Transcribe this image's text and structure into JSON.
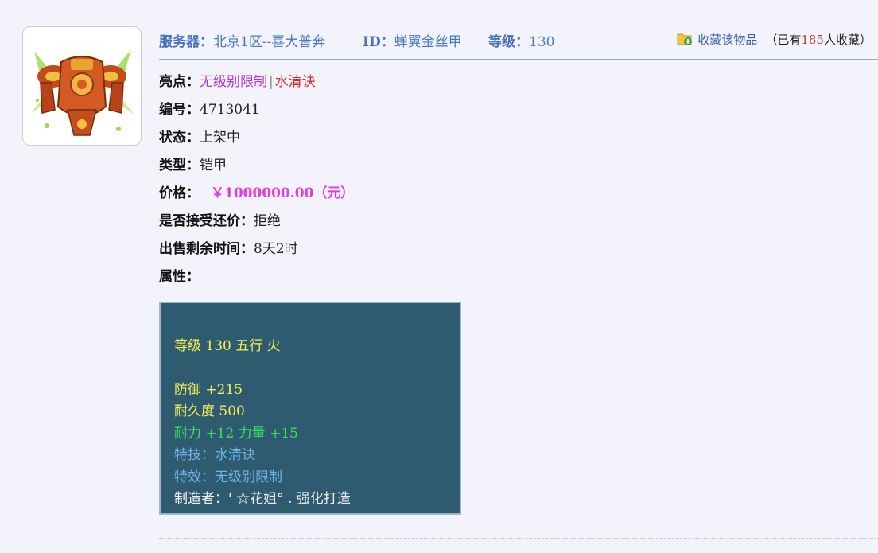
{
  "header": {
    "server_label": "服务器：",
    "server_value": "北京1区--喜大普奔",
    "id_label": "ID：",
    "id_value": "蝉翼金丝甲",
    "level_label": "等级：",
    "level_value": "130",
    "favorite_link": "收藏该物品",
    "favorite_prefix": "（已有",
    "favorite_count": "185",
    "favorite_suffix": "人收藏）"
  },
  "details": {
    "highlight_label": "亮点：",
    "highlight_1": "无级别限制",
    "highlight_sep": "|",
    "highlight_2": "水清诀",
    "number_label": "编号：",
    "number_value": "4713041",
    "status_label": "状态：",
    "status_value": "上架中",
    "type_label": "类型：",
    "type_value": "铠甲",
    "price_label": "价格：",
    "price_value": "￥1000000.00（元）",
    "bargain_label": "是否接受还价：",
    "bargain_value": "拒绝",
    "time_label": "出售剩余时间：",
    "time_value": "8天2时",
    "attr_label": "属性："
  },
  "attributes": {
    "line1": "等级 130 五行 火",
    "line2": "防御 +215",
    "line3": "耐久度 500",
    "line4": "耐力 +12 力量 +15",
    "line5": "特技：水清诀",
    "line6": "特效：无级别限制",
    "line7": "制造者：' ☆花姐° . 强化打造"
  },
  "colors": {
    "page_bg": "#f3f4fb",
    "link_blue": "#4a78c8",
    "highlight_purple": "#b535d1",
    "highlight_red": "#e0282a",
    "price_magenta": "#e23ae0",
    "attr_box_bg": "#2f5b70",
    "attr_yellow": "#f3f05a",
    "attr_green": "#35e35a",
    "attr_blue": "#6fb4e8"
  },
  "icons": {
    "item_image": "armor-item-icon",
    "favorite": "folder-add-icon"
  }
}
